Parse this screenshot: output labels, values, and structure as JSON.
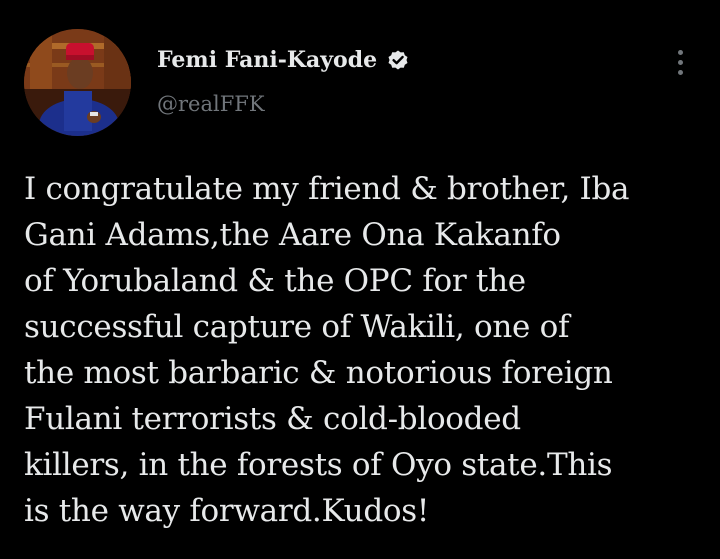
{
  "author": {
    "display_name": "Femi Fani-Kayode",
    "handle": "@realFFK",
    "verified": true
  },
  "tweet": {
    "lines": [
      "I congratulate my friend & brother, Iba",
      "Gani Adams,the Aare Ona Kakanfo",
      "of Yorubaland & the OPC for the",
      "successful capture of Wakili, one of",
      "the most barbaric & notorious foreign",
      "Fulani terrorists & cold-blooded",
      "killers, in the forests of Oyo state.This",
      "is the way forward.Kudos!"
    ]
  },
  "icons": {
    "verified": "verified-badge-icon",
    "more": "more-options-icon"
  },
  "colors": {
    "background": "#000000",
    "primary_text": "#e7e9ea",
    "secondary_text": "#71767b",
    "avatar_cap": "#c8102e",
    "avatar_robe": "#1c2f8c"
  }
}
